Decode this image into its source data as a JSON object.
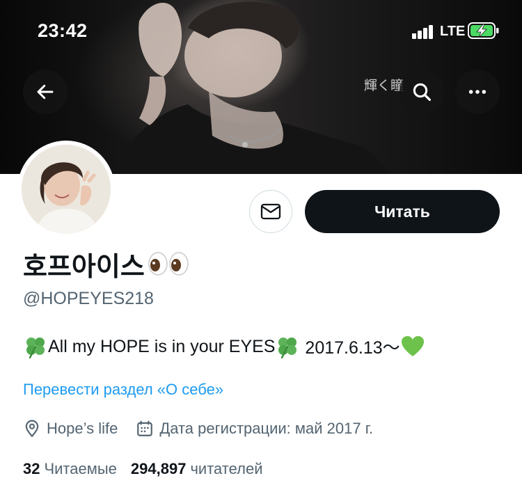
{
  "status_bar": {
    "time": "23:42",
    "network": "LTE",
    "battery_charging": true
  },
  "header": {
    "banner_overlay_text": "輝く瞳",
    "buttons": {
      "back": "arrow-left-icon",
      "search": "search-icon",
      "more": "more-horizontal-icon"
    }
  },
  "profile": {
    "display_name": "호프아이스",
    "name_emoji": "eyes-emoji",
    "handle": "@HOPEYES218",
    "bio": {
      "part1": "All my HOPE is in your EYES",
      "part2": " 2017.6.13～",
      "icons": [
        "four-leaf-clover-emoji",
        "four-leaf-clover-emoji",
        "green-heart-emoji"
      ]
    },
    "translate_bio_link": "Перевести раздел «О себе»",
    "location": "Hope’s life",
    "joined": "Дата регистрации: май 2017 г.",
    "following_count": "32",
    "following_label": "Читаемые",
    "followers_count": "294,897",
    "followers_label": "читателей"
  },
  "actions": {
    "follow_label": "Читать",
    "message_icon": "envelope-icon"
  },
  "colors": {
    "accent": "#1d9bf0",
    "primary_button": "#0f1419",
    "secondary_text": "#536471"
  }
}
